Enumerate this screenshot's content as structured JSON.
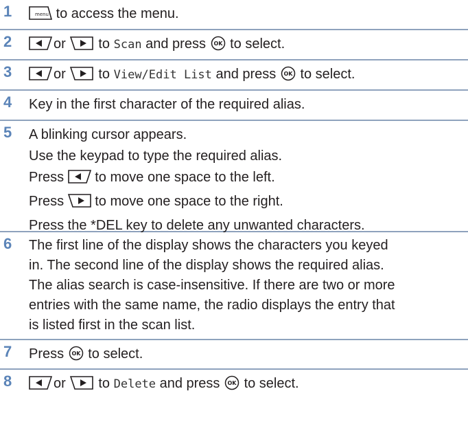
{
  "steps": [
    {
      "number": "1",
      "icon": "menu-key-icon",
      "menu_label": "menu",
      "text": "to access the menu."
    },
    {
      "number": "2",
      "or": "or",
      "to": "to",
      "target": "Scan",
      "press": "and press",
      "end": "to select."
    },
    {
      "number": "3",
      "or": "or",
      "to": "to",
      "target": "View/Edit List",
      "press": "and press",
      "end": "to select."
    },
    {
      "number": "4",
      "text": "Key in the first character of the required alias."
    },
    {
      "number": "5",
      "line1": "A blinking cursor appears.",
      "line2": "Use the keypad to type the required alias.",
      "line3_pre": "Press",
      "line3_post": "to move one space to the left.",
      "line4_pre": "Press",
      "line4_post": "to move one space to the right.",
      "line5": "Press the *DEL key to delete any unwanted characters."
    },
    {
      "number": "6",
      "line1": "The first line of the display shows the characters you keyed",
      "line2": "in. The second line of the display shows the required alias.",
      "line3": "The alias search is case-insensitive. If there are two or more",
      "line4": "entries with the same name, the radio displays the entry that",
      "line5": "is listed first in the scan list."
    },
    {
      "number": "7",
      "pre": "Press",
      "post": "to select."
    },
    {
      "number": "8",
      "or": "or",
      "to": "to",
      "target": "Delete",
      "press": "and press",
      "end": "to select."
    }
  ],
  "ok_label": "OK",
  "colors": {
    "step_number": "#5b84b8",
    "divider": "#8ea2bd",
    "text": "#231f20"
  }
}
